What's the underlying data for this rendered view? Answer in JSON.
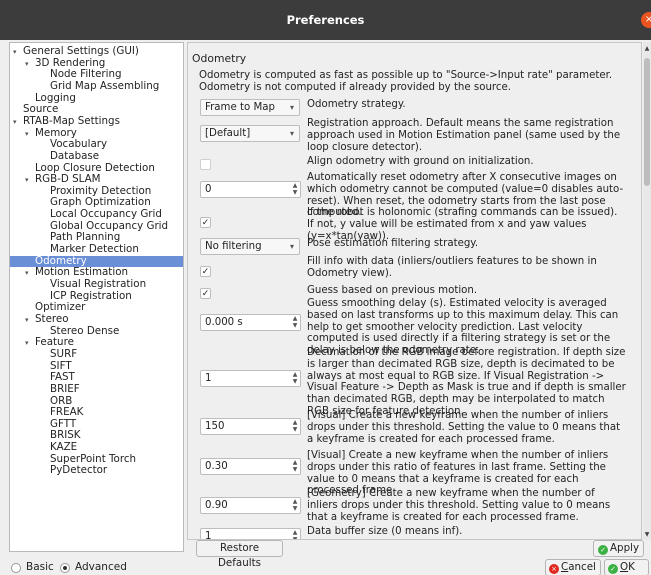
{
  "window": {
    "title": "Preferences",
    "close_glyph": "×"
  },
  "tree": [
    {
      "label": "General Settings (GUI)",
      "arrow": "▾",
      "level": 0
    },
    {
      "label": "3D Rendering",
      "arrow": "▾",
      "level": 1
    },
    {
      "label": "Node Filtering",
      "arrow": "",
      "level": 2
    },
    {
      "label": "Grid Map Assembling",
      "arrow": "",
      "level": 2
    },
    {
      "label": "Logging",
      "arrow": "",
      "level": 1
    },
    {
      "label": "Source",
      "arrow": "",
      "level": 0
    },
    {
      "label": "RTAB-Map Settings",
      "arrow": "▾",
      "level": 0
    },
    {
      "label": "Memory",
      "arrow": "▾",
      "level": 1
    },
    {
      "label": "Vocabulary",
      "arrow": "",
      "level": 2
    },
    {
      "label": "Database",
      "arrow": "",
      "level": 2
    },
    {
      "label": "Loop Closure Detection",
      "arrow": "",
      "level": 1
    },
    {
      "label": "RGB-D SLAM",
      "arrow": "▾",
      "level": 1
    },
    {
      "label": "Proximity Detection",
      "arrow": "",
      "level": 2
    },
    {
      "label": "Graph Optimization",
      "arrow": "",
      "level": 2
    },
    {
      "label": "Local Occupancy Grid",
      "arrow": "",
      "level": 2
    },
    {
      "label": "Global Occupancy Grid",
      "arrow": "",
      "level": 2
    },
    {
      "label": "Path Planning",
      "arrow": "",
      "level": 2
    },
    {
      "label": "Marker Detection",
      "arrow": "",
      "level": 2
    },
    {
      "label": "Odometry",
      "arrow": "",
      "level": 1,
      "selected": true
    },
    {
      "label": "Motion Estimation",
      "arrow": "▾",
      "level": 1
    },
    {
      "label": "Visual Registration",
      "arrow": "",
      "level": 2
    },
    {
      "label": "ICP Registration",
      "arrow": "",
      "level": 2
    },
    {
      "label": "Optimizer",
      "arrow": "",
      "level": 1
    },
    {
      "label": "Stereo",
      "arrow": "▾",
      "level": 1
    },
    {
      "label": "Stereo Dense",
      "arrow": "",
      "level": 2
    },
    {
      "label": "Feature",
      "arrow": "▾",
      "level": 1
    },
    {
      "label": "SURF",
      "arrow": "",
      "level": 2
    },
    {
      "label": "SIFT",
      "arrow": "",
      "level": 2
    },
    {
      "label": "FAST",
      "arrow": "",
      "level": 2
    },
    {
      "label": "BRIEF",
      "arrow": "",
      "level": 2
    },
    {
      "label": "ORB",
      "arrow": "",
      "level": 2
    },
    {
      "label": "FREAK",
      "arrow": "",
      "level": 2
    },
    {
      "label": "GFTT",
      "arrow": "",
      "level": 2
    },
    {
      "label": "BRISK",
      "arrow": "",
      "level": 2
    },
    {
      "label": "KAZE",
      "arrow": "",
      "level": 2
    },
    {
      "label": "SuperPoint Torch",
      "arrow": "",
      "level": 2
    },
    {
      "label": "PyDetector",
      "arrow": "",
      "level": 2
    }
  ],
  "panel": {
    "section_title": "Odometry",
    "description": "Odometry is computed as fast as possible up to \"Source->Input rate\" parameter. Odometry is not computed if already provided by the source.",
    "rows": [
      {
        "kind": "combo",
        "value": "Frame to Map",
        "label": "Odometry strategy."
      },
      {
        "kind": "combo",
        "value": "[Default]",
        "label": "Registration approach. Default means the same registration approach used in Motion Estimation panel (same used by the loop closure detector)."
      },
      {
        "kind": "check",
        "checked": false,
        "label": "Align odometry with ground on initialization."
      },
      {
        "kind": "spin",
        "value": "0",
        "label": "Automatically reset odometry after X consecutive images on which odometry cannot be computed (value=0 disables auto-reset). When reset, the odometry starts from the last pose computed."
      },
      {
        "kind": "check",
        "checked": true,
        "label": "If the robot is holonomic (strafing commands can be issued). If not, y value will be estimated from x and yaw values (y=x*tan(yaw))."
      },
      {
        "kind": "combo",
        "value": "No filtering",
        "label": "Pose estimation filtering strategy."
      },
      {
        "kind": "check",
        "checked": true,
        "label": "Fill info with data (inliers/outliers features to be shown in Odometry view)."
      },
      {
        "kind": "check",
        "checked": true,
        "label": "Guess based on previous motion."
      },
      {
        "kind": "spin",
        "value": "0.000 s",
        "label": "Guess smoothing delay (s). Estimated velocity is averaged based on last transforms up to this maximum delay. This can help to get smoother velocity prediction. Last velocity computed is used directly if a filtering strategy is set or the delay is below the odometry rate."
      },
      {
        "kind": "spin",
        "value": "1",
        "label": "Decimation of the RGB image before registration. If depth size is larger than decimated RGB size, depth is decimated to be always at most equal to RGB size. If Visual Registration -> Visual Feature -> Depth as Mask is true and if depth is smaller than decimated RGB, depth may be interpolated to match RGB size for feature detection."
      },
      {
        "kind": "spin",
        "value": "150",
        "label": "[Visual] Create a new keyframe when the number of inliers drops under this threshold. Setting the value to 0 means that a keyframe is created for each processed frame."
      },
      {
        "kind": "spin",
        "value": "0.30",
        "label": "[Visual] Create a new keyframe when the number of inliers drops under this ratio of features in last frame. Setting the value to 0 means that a keyframe is created for each processed frame."
      },
      {
        "kind": "spin",
        "value": "0.90",
        "label": "[Geometry] Create a new keyframe when the number of inliers drops under this threshold. Setting value to 0 means that a keyframe is created for each processed frame."
      },
      {
        "kind": "spin",
        "value": "1",
        "label": "Data buffer size (0 means inf)."
      }
    ]
  },
  "buttons": {
    "restore": "Restore Defaults",
    "apply": "Apply",
    "cancel_pre": "",
    "cancel_u": "C",
    "cancel_post": "ancel",
    "ok_u": "O",
    "ok_post": "K"
  },
  "mode": {
    "basic": "Basic",
    "advanced": "Advanced",
    "selected": "advanced"
  },
  "colors": {
    "selection": "#6b8fd6",
    "titlebar": "#3c3c3c",
    "close": "#e95420",
    "apply_icon": "#3bb143",
    "cancel_icon": "#e0281e"
  },
  "icons": {
    "apply": "check-circle-icon",
    "ok": "check-circle-icon",
    "cancel": "cancel-circle-icon",
    "close": "close-icon"
  }
}
